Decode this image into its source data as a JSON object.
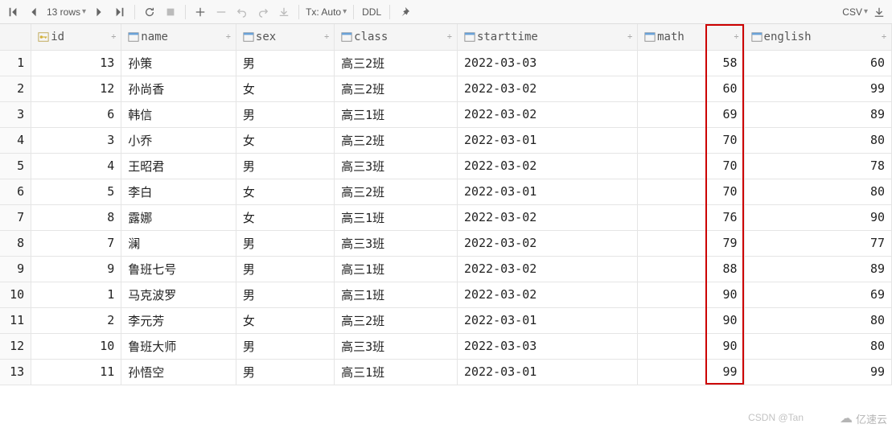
{
  "toolbar": {
    "row_count_label": "13 rows",
    "tx_label": "Tx: Auto",
    "ddl_label": "DDL",
    "export_label": "CSV"
  },
  "columns": [
    {
      "key": "id",
      "label": "id",
      "icon": "key"
    },
    {
      "key": "name",
      "label": "name",
      "icon": "col"
    },
    {
      "key": "sex",
      "label": "sex",
      "icon": "col"
    },
    {
      "key": "class",
      "label": "class",
      "icon": "col"
    },
    {
      "key": "starttime",
      "label": "starttime",
      "icon": "col"
    },
    {
      "key": "math",
      "label": "math",
      "icon": "col"
    },
    {
      "key": "english",
      "label": "english",
      "icon": "col"
    }
  ],
  "rows": [
    {
      "n": 1,
      "id": 13,
      "name": "孙策",
      "sex": "男",
      "class": "高三2班",
      "starttime": "2022-03-03",
      "math": 58,
      "english": 60
    },
    {
      "n": 2,
      "id": 12,
      "name": "孙尚香",
      "sex": "女",
      "class": "高三2班",
      "starttime": "2022-03-02",
      "math": 60,
      "english": 99
    },
    {
      "n": 3,
      "id": 6,
      "name": "韩信",
      "sex": "男",
      "class": "高三1班",
      "starttime": "2022-03-02",
      "math": 69,
      "english": 89
    },
    {
      "n": 4,
      "id": 3,
      "name": "小乔",
      "sex": "女",
      "class": "高三2班",
      "starttime": "2022-03-01",
      "math": 70,
      "english": 80
    },
    {
      "n": 5,
      "id": 4,
      "name": "王昭君",
      "sex": "男",
      "class": "高三3班",
      "starttime": "2022-03-02",
      "math": 70,
      "english": 78
    },
    {
      "n": 6,
      "id": 5,
      "name": "李白",
      "sex": "女",
      "class": "高三2班",
      "starttime": "2022-03-01",
      "math": 70,
      "english": 80
    },
    {
      "n": 7,
      "id": 8,
      "name": "露娜",
      "sex": "女",
      "class": "高三1班",
      "starttime": "2022-03-02",
      "math": 76,
      "english": 90
    },
    {
      "n": 8,
      "id": 7,
      "name": "澜",
      "sex": "男",
      "class": "高三3班",
      "starttime": "2022-03-02",
      "math": 79,
      "english": 77
    },
    {
      "n": 9,
      "id": 9,
      "name": "鲁班七号",
      "sex": "男",
      "class": "高三1班",
      "starttime": "2022-03-02",
      "math": 88,
      "english": 89
    },
    {
      "n": 10,
      "id": 1,
      "name": "马克波罗",
      "sex": "男",
      "class": "高三1班",
      "starttime": "2022-03-02",
      "math": 90,
      "english": 69
    },
    {
      "n": 11,
      "id": 2,
      "name": "李元芳",
      "sex": "女",
      "class": "高三2班",
      "starttime": "2022-03-01",
      "math": 90,
      "english": 80
    },
    {
      "n": 12,
      "id": 10,
      "name": "鲁班大师",
      "sex": "男",
      "class": "高三3班",
      "starttime": "2022-03-03",
      "math": 90,
      "english": 80
    },
    {
      "n": 13,
      "id": 11,
      "name": "孙悟空",
      "sex": "男",
      "class": "高三1班",
      "starttime": "2022-03-01",
      "math": 99,
      "english": 99
    }
  ],
  "highlight_column": "math",
  "watermarks": {
    "left": "CSDN @Tan",
    "right": "亿速云"
  },
  "chart_data": {
    "type": "table",
    "title": "",
    "columns": [
      "id",
      "name",
      "sex",
      "class",
      "starttime",
      "math",
      "english"
    ],
    "rows": [
      [
        13,
        "孙策",
        "男",
        "高三2班",
        "2022-03-03",
        58,
        60
      ],
      [
        12,
        "孙尚香",
        "女",
        "高三2班",
        "2022-03-02",
        60,
        99
      ],
      [
        6,
        "韩信",
        "男",
        "高三1班",
        "2022-03-02",
        69,
        89
      ],
      [
        3,
        "小乔",
        "女",
        "高三2班",
        "2022-03-01",
        70,
        80
      ],
      [
        4,
        "王昭君",
        "男",
        "高三3班",
        "2022-03-02",
        70,
        78
      ],
      [
        5,
        "李白",
        "女",
        "高三2班",
        "2022-03-01",
        70,
        80
      ],
      [
        8,
        "露娜",
        "女",
        "高三1班",
        "2022-03-02",
        76,
        90
      ],
      [
        7,
        "澜",
        "男",
        "高三3班",
        "2022-03-02",
        79,
        77
      ],
      [
        9,
        "鲁班七号",
        "男",
        "高三1班",
        "2022-03-02",
        88,
        89
      ],
      [
        1,
        "马克波罗",
        "男",
        "高三1班",
        "2022-03-02",
        90,
        69
      ],
      [
        2,
        "李元芳",
        "女",
        "高三2班",
        "2022-03-01",
        90,
        80
      ],
      [
        10,
        "鲁班大师",
        "男",
        "高三3班",
        "2022-03-03",
        90,
        80
      ],
      [
        11,
        "孙悟空",
        "男",
        "高三1班",
        "2022-03-01",
        99,
        99
      ]
    ]
  }
}
